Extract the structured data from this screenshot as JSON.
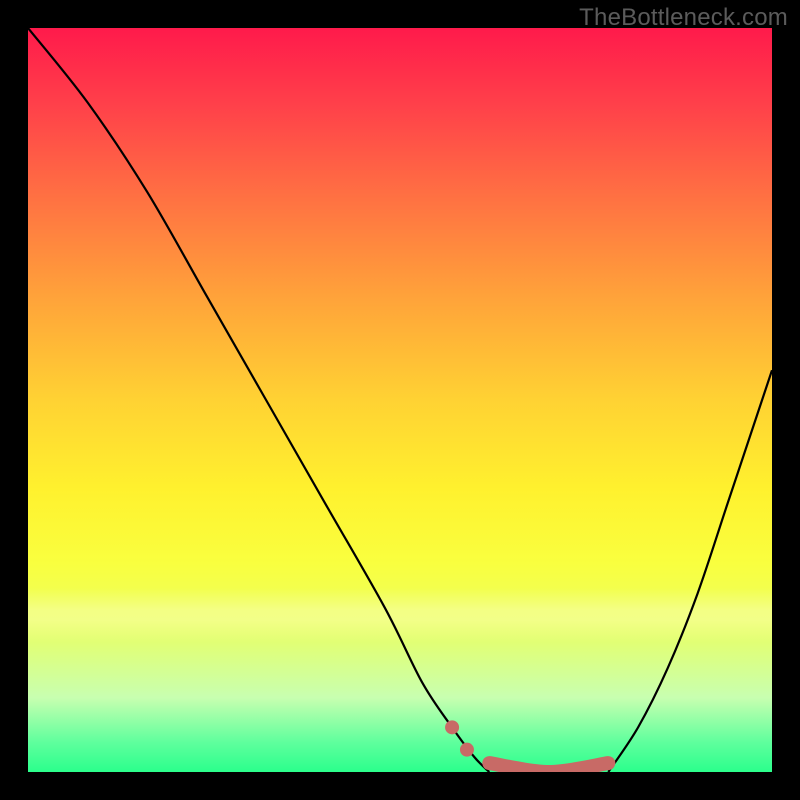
{
  "watermark": "TheBottleneck.com",
  "colors": {
    "background": "#000000",
    "curve": "#000000",
    "accent": "#c86a66",
    "gradient_top": "#ff1a4b",
    "gradient_mid": "#fff12e",
    "gradient_bottom": "#2bff8c"
  },
  "chart_data": {
    "type": "line",
    "title": "",
    "xlabel": "",
    "ylabel": "",
    "xlim": [
      0,
      100
    ],
    "ylim": [
      0,
      100
    ],
    "series": [
      {
        "name": "left-curve",
        "x": [
          0,
          8,
          16,
          24,
          32,
          40,
          48,
          53,
          57,
          60,
          62
        ],
        "y": [
          100,
          90,
          78,
          64,
          50,
          36,
          22,
          12,
          6,
          2,
          0
        ]
      },
      {
        "name": "right-curve",
        "x": [
          78,
          82,
          86,
          90,
          94,
          98,
          100
        ],
        "y": [
          0,
          6,
          14,
          24,
          36,
          48,
          54
        ]
      },
      {
        "name": "valley-flat",
        "x": [
          62,
          78
        ],
        "y": [
          0,
          0
        ]
      }
    ],
    "markers": [
      {
        "name": "dot-1",
        "x": 57,
        "y": 6
      },
      {
        "name": "dot-2",
        "x": 59,
        "y": 3
      }
    ]
  }
}
